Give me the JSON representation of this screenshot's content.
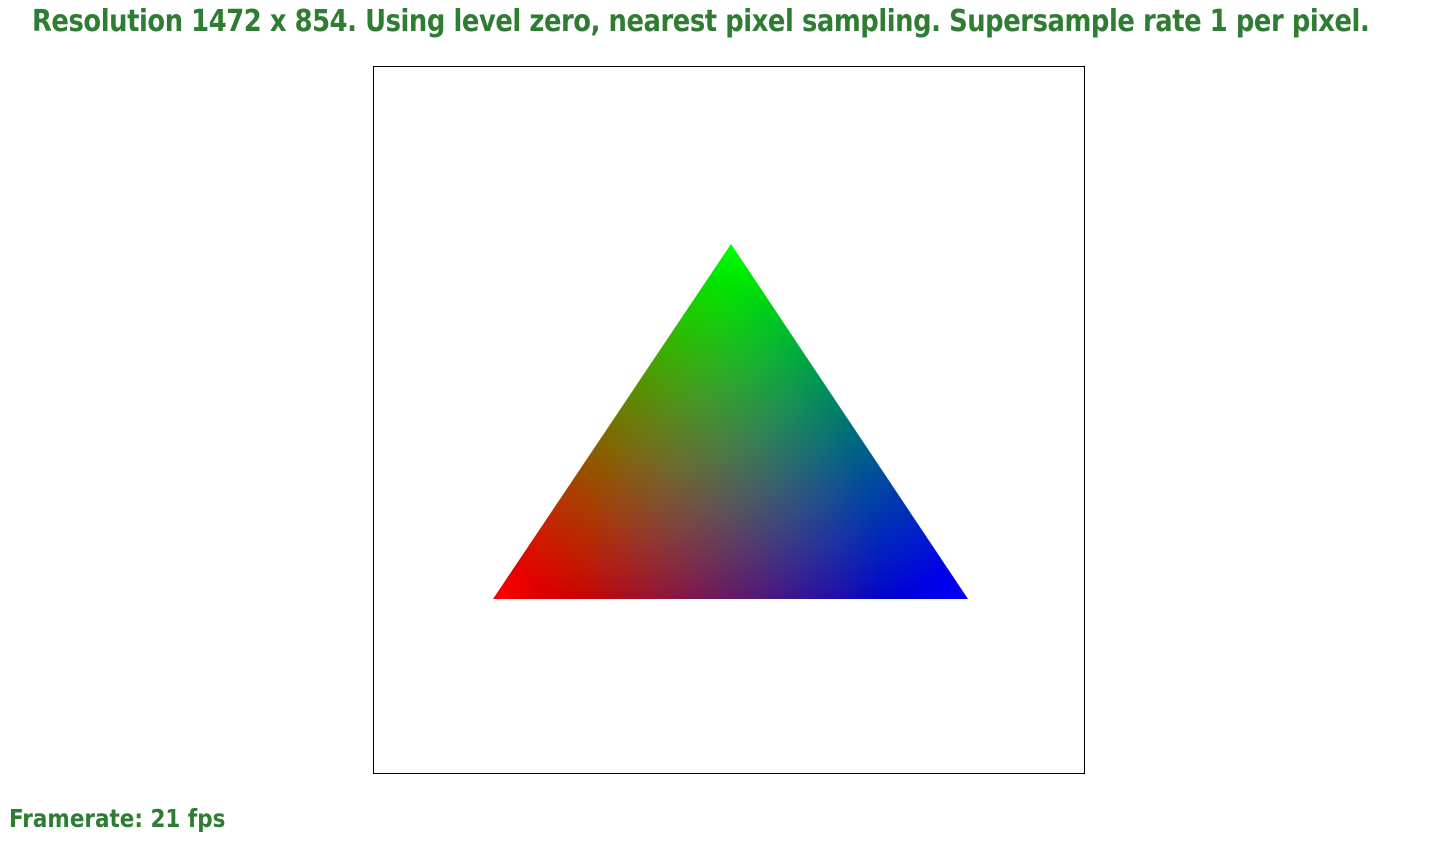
{
  "header": {
    "status_text": "Resolution 1472 x 854. Using level zero, nearest pixel sampling. Supersample rate 1 per pixel."
  },
  "footer": {
    "framerate_text": "Framerate: 21 fps"
  },
  "scene": {
    "shape": "triangle",
    "vertex_colors": {
      "top": "#00ff00",
      "bottom_left": "#ff0000",
      "bottom_right": "#0000ff"
    },
    "text_color": "#2e7d32",
    "frame_color": "#000000",
    "background": "#ffffff"
  }
}
